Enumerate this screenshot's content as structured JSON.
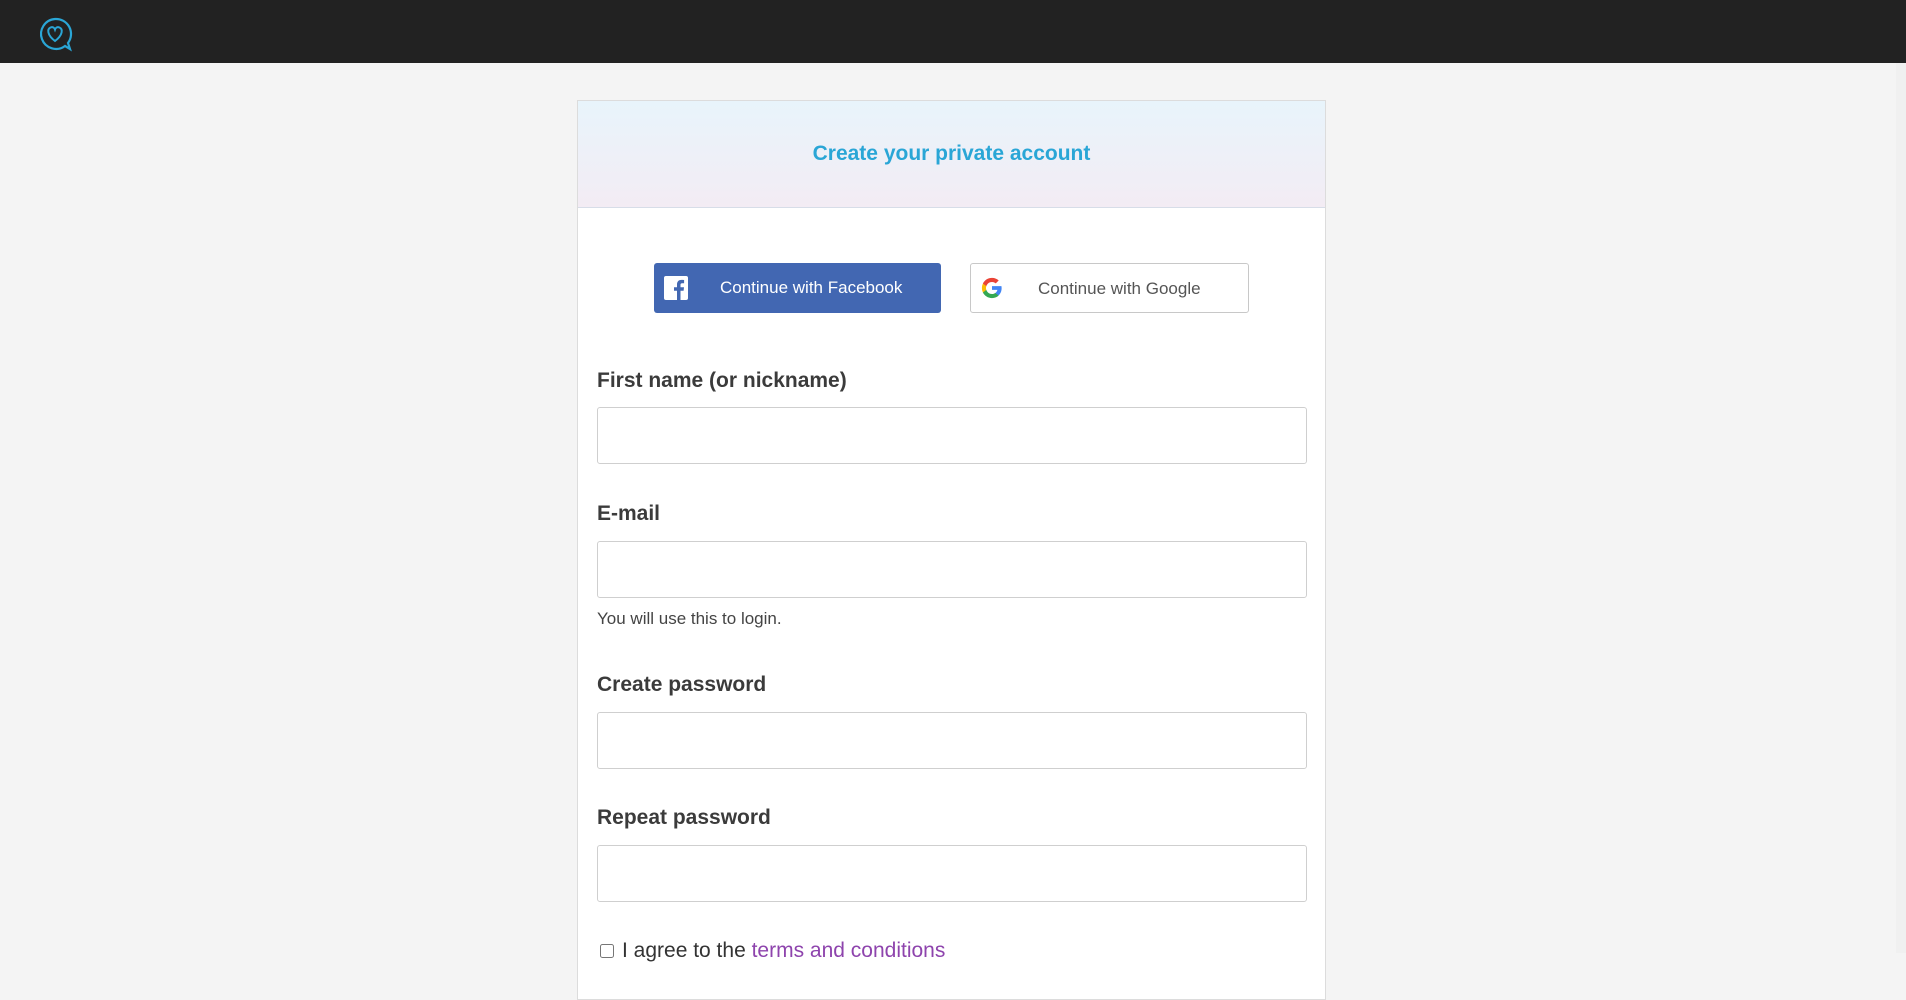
{
  "header": {
    "logo_icon": "heart-chat-bubble-icon"
  },
  "card": {
    "title": "Create your private account",
    "facebook_label": "Continue with Facebook",
    "google_label": "Continue with Google",
    "fields": {
      "first_name_label": "First name (or nickname)",
      "email_label": "E-mail",
      "email_hint": "You will use this to login.",
      "password_label": "Create password",
      "repeat_password_label": "Repeat password"
    },
    "terms_prefix": "I agree to the ",
    "terms_link": "terms and conditions"
  },
  "colors": {
    "topbar": "#222222",
    "accent": "#2aa6d6",
    "facebook": "#4267b2",
    "link": "#8e44ad"
  }
}
